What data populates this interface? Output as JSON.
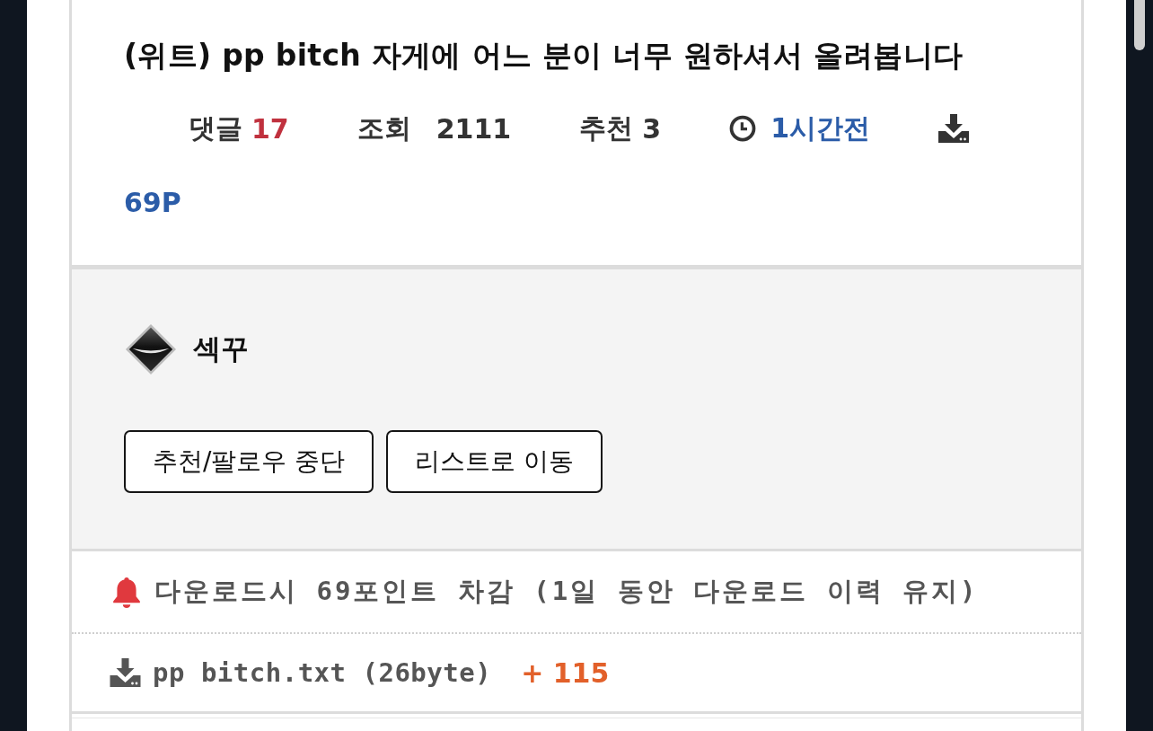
{
  "post": {
    "title": "(위트) pp bitch 자게에 어느 분이 너무 원하셔서 올려봅니다",
    "meta": {
      "comments_label": "댓글",
      "comments": "17",
      "views_label": "조회",
      "views": "2111",
      "recommend_label": "추천",
      "recommend": "3",
      "time": "1시간전"
    },
    "price": "69P"
  },
  "author": {
    "name": "섹꾸"
  },
  "buttons": [
    "추천/팔로우 중단",
    "리스트로 이동"
  ],
  "download_notice": "다운로드시 69포인트 차감 (1일 동안 다운로드 이력 유지)",
  "attachments": [
    {
      "filename": "pp bitch.txt (26byte)",
      "count": "+ 115"
    }
  ]
}
